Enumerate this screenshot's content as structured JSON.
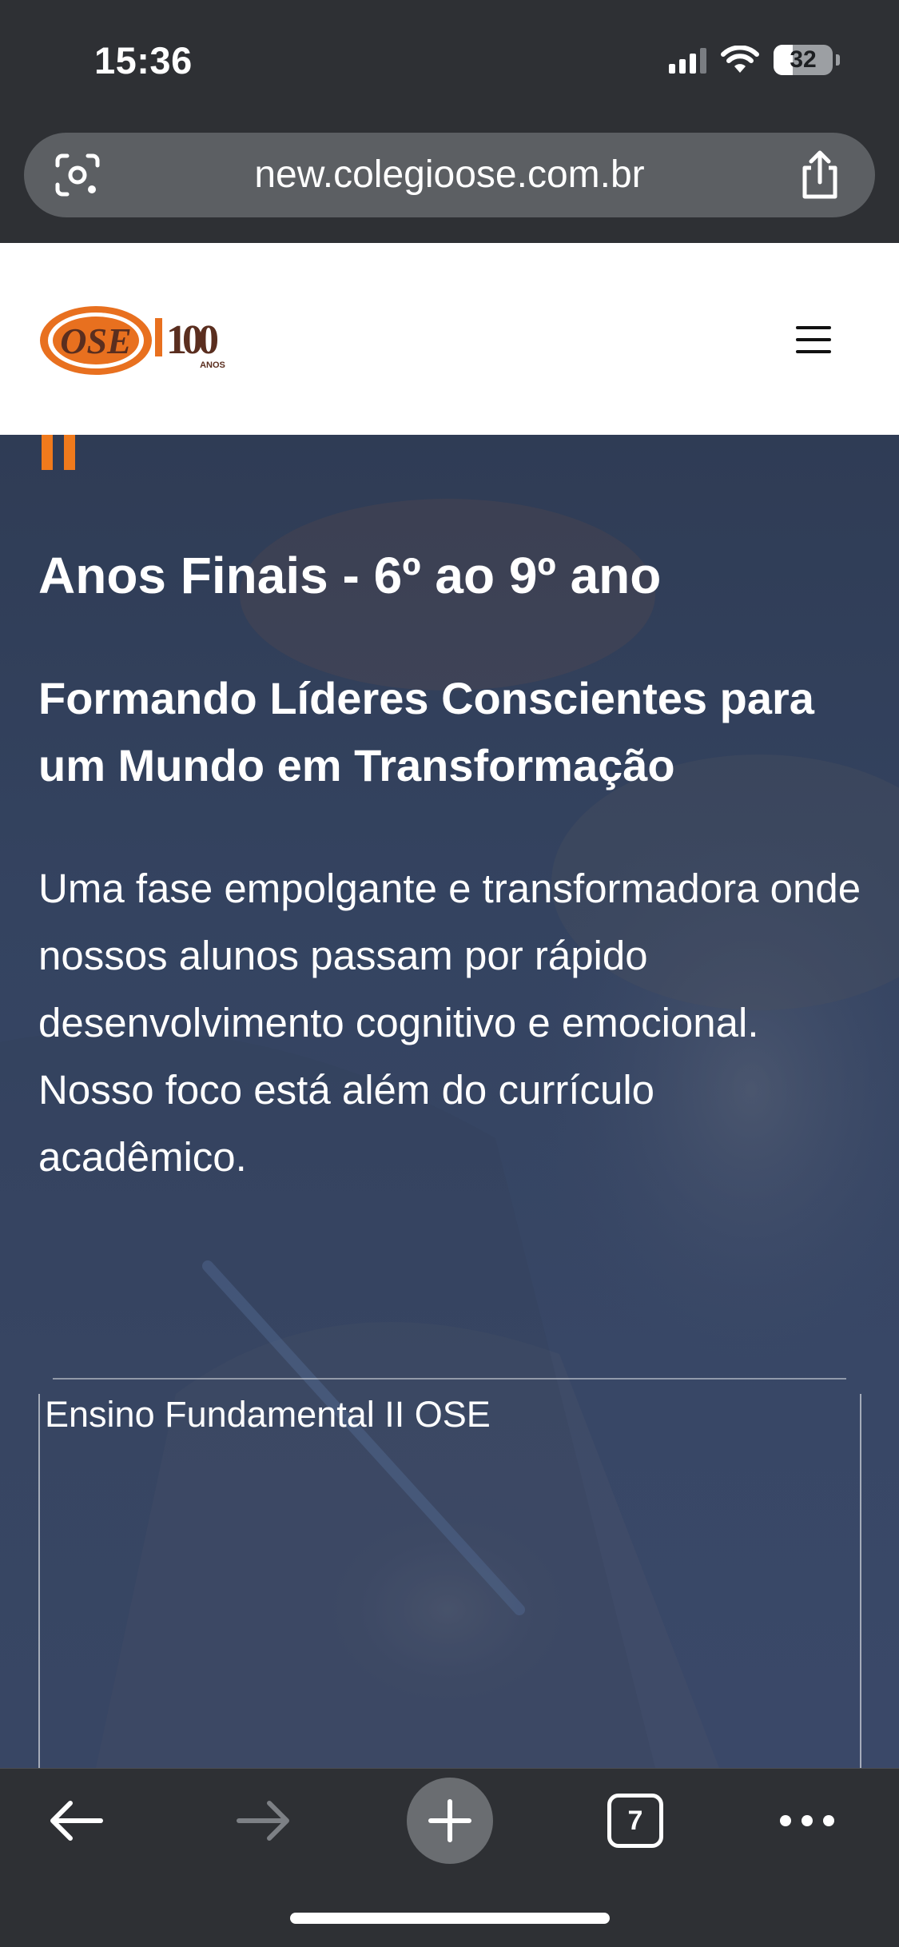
{
  "status_bar": {
    "time": "15:36",
    "battery_level": "32",
    "icons": [
      "cellular-signal-icon",
      "wifi-icon",
      "battery-icon"
    ]
  },
  "browser": {
    "url": "new.colegioose.com.br",
    "icons": [
      "lens-icon",
      "share-icon"
    ],
    "toolbar": {
      "tab_count": "7",
      "icons": [
        "back-arrow-icon",
        "forward-arrow-icon",
        "plus-icon",
        "tabs-icon",
        "more-dots-icon"
      ]
    }
  },
  "site": {
    "logo_text": "OSE",
    "logo_badge": "100",
    "logo_badge_caption": "ANOS",
    "accent_color": "#f07a1c",
    "logo_dark_color": "#5a2e1f"
  },
  "hero": {
    "title": "Anos Finais - 6º ao 9º ano",
    "subtitle": "Formando Líderes Conscientes para um Mundo em Transformação",
    "body": "Uma fase empolgante e transformadora onde nossos alunos passam por rápido desenvolvimento cognitivo e emocional. Nosso foco está além do currículo acadêmico.",
    "video_title": "Ensino Fundamental II OSE"
  }
}
